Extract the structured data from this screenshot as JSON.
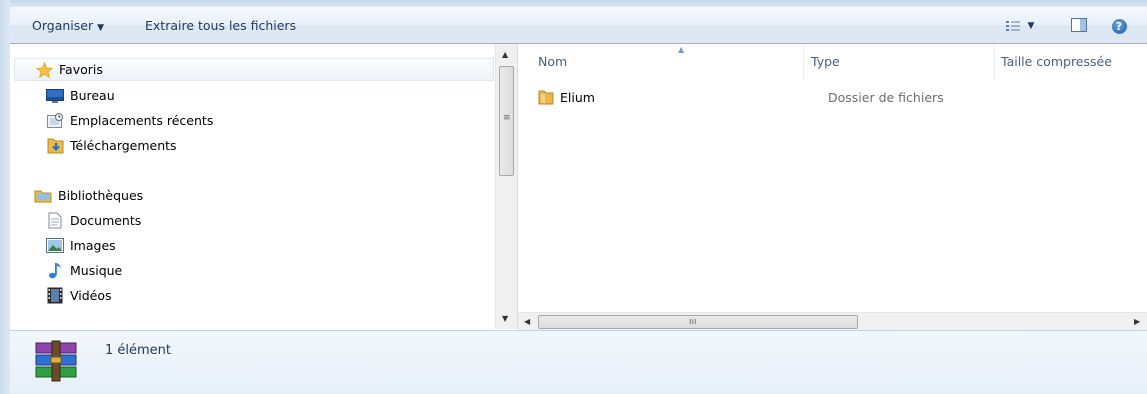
{
  "toolbar": {
    "organise_label": "Organiser",
    "organise_caret": "▼",
    "extract_label": "Extraire tous les fichiers",
    "views_caret": "▼",
    "help_glyph": "?"
  },
  "nav": {
    "favorites": {
      "label": "Favoris",
      "icon": "star-icon",
      "items": [
        {
          "label": "Bureau",
          "icon": "desktop-icon"
        },
        {
          "label": "Emplacements récents",
          "icon": "recent-places-icon"
        },
        {
          "label": "Téléchargements",
          "icon": "downloads-folder-icon"
        }
      ]
    },
    "libraries": {
      "label": "Bibliothèques",
      "icon": "libraries-icon",
      "items": [
        {
          "label": "Documents",
          "icon": "documents-icon"
        },
        {
          "label": "Images",
          "icon": "pictures-icon"
        },
        {
          "label": "Musique",
          "icon": "music-icon"
        },
        {
          "label": "Vidéos",
          "icon": "videos-icon"
        }
      ]
    },
    "scroll_grip": "≡"
  },
  "columns": [
    {
      "label": "Nom"
    },
    {
      "label": "Type"
    },
    {
      "label": "Taille compressée"
    }
  ],
  "files": [
    {
      "name": "Elium",
      "type": "Dossier de fichiers",
      "icon": "folder-icon"
    }
  ],
  "hscroll_grip": "ııı",
  "status": {
    "count": "1 élément",
    "icon": "winrar-archive-icon"
  },
  "colors": {
    "toolbar_bg": "#dfe9f5",
    "text": "#1e395b",
    "folder": "#e8b84a"
  }
}
